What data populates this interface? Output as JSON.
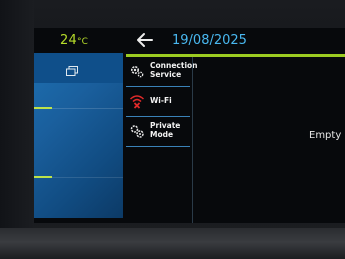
{
  "status": {
    "temperature": "24",
    "temperature_unit": "°C",
    "date": "19/08/2025"
  },
  "menu": {
    "items": [
      {
        "label_line1": "Connection",
        "label_line2": "Service",
        "icon": "gear-icon"
      },
      {
        "label_line1": "Wi-Fi",
        "label_line2": "",
        "icon": "wifi-off-icon"
      },
      {
        "label_line1": "Private",
        "label_line2": "Mode",
        "icon": "privacy-gear-icon"
      }
    ]
  },
  "main": {
    "empty_text": "Empty l"
  },
  "colors": {
    "accent_green": "#9ccc21",
    "date_blue": "#49b8f0",
    "panel_blue": "#1a5f9d",
    "wifi_red": "#e02a2a"
  }
}
